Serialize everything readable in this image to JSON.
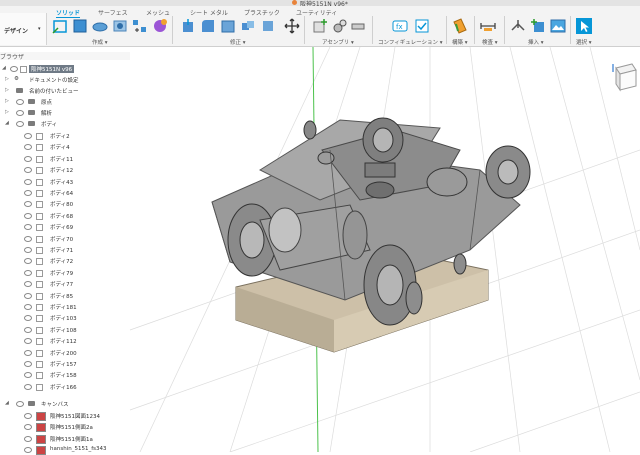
{
  "window": {
    "title": "阪神5151N v96*"
  },
  "workspace": {
    "label": "デザイン"
  },
  "ribbon": {
    "tabs": [
      {
        "label": "ソリッド",
        "active": true
      },
      {
        "label": "サーフェス"
      },
      {
        "label": "メッシュ"
      },
      {
        "label": "シート メタル"
      },
      {
        "label": "プラスチック"
      },
      {
        "label": "ユーティリティ"
      }
    ],
    "groups": {
      "create": "作成",
      "modify": "修正",
      "assemble": "アセンブリ",
      "configure": "コンフィギュレーション",
      "construct": "構築",
      "inspect": "検査",
      "insert": "挿入",
      "select": "選択"
    }
  },
  "browser": {
    "header": "ブラウザ",
    "root": "阪神5151N v96",
    "items": {
      "doc_settings": "ドキュメントの設定",
      "named_views": "名前の付いたビュー",
      "origin": "原点",
      "analysis": "解析",
      "bodies": "ボディ",
      "canvases": "キャンバス"
    },
    "bodies": [
      "ボディ2",
      "ボディ4",
      "ボディ11",
      "ボディ12",
      "ボディ43",
      "ボディ64",
      "ボディ80",
      "ボディ68",
      "ボディ69",
      "ボディ70",
      "ボディ71",
      "ボディ72",
      "ボディ79",
      "ボディ77",
      "ボディ85",
      "ボディ181",
      "ボディ103",
      "ボディ108",
      "ボディ112",
      "ボディ200",
      "ボディ157",
      "ボディ158",
      "ボディ166"
    ],
    "canvas_items": [
      "阪神5151図面1234",
      "阪神5151側面2a",
      "阪神5151側面1a",
      "hanshin_5151_fs343"
    ]
  },
  "colors": {
    "accent": "#0696d7",
    "model": "#8a8a8a",
    "base": "#c9bda7",
    "axis_green": "#4cc24c"
  },
  "icons": [
    "sketch-icon",
    "extrude-icon",
    "revolve-icon",
    "fillet-icon",
    "move-icon",
    "joint-icon",
    "parameters-icon",
    "plane-icon",
    "measure-icon",
    "insert-icon",
    "select-icon"
  ]
}
